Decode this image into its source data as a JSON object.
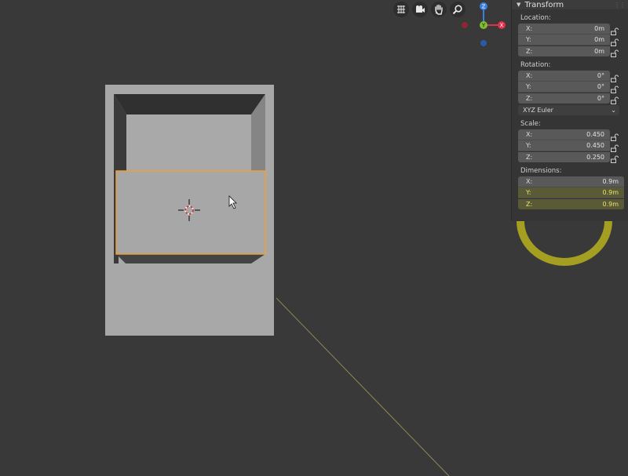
{
  "viewport": {
    "tools": [
      {
        "name": "grid-icon"
      },
      {
        "name": "camera-icon"
      },
      {
        "name": "hand-icon"
      },
      {
        "name": "zoom-icon"
      }
    ],
    "gizmo": {
      "z_label": "Z",
      "y_label": "Y",
      "x_label": "X",
      "colors": {
        "x": "#e0304a",
        "y": "#7fbf2f",
        "z": "#3a7fe0"
      }
    }
  },
  "panel": {
    "title": "Transform",
    "location": {
      "label": "Location:",
      "x_label": "X:",
      "x": "0m",
      "y_label": "Y:",
      "y": "0m",
      "z_label": "Z:",
      "z": "0m"
    },
    "rotation": {
      "label": "Rotation:",
      "x_label": "X:",
      "x": "0°",
      "y_label": "Y:",
      "y": "0°",
      "z_label": "Z:",
      "z": "0°"
    },
    "rotation_mode": "XYZ Euler",
    "scale": {
      "label": "Scale:",
      "x_label": "X:",
      "x": "0.450",
      "y_label": "Y:",
      "y": "0.450",
      "z_label": "Z:",
      "z": "0.250"
    },
    "dimensions": {
      "label": "Dimensions:",
      "x_label": "X:",
      "x": "0.9m",
      "y_label": "Y:",
      "y": "0.9m",
      "z_label": "Z:",
      "z": "0.9m"
    }
  },
  "colors": {
    "background": "#393939",
    "selection": "#f0a030",
    "annotation": "#c8c01a"
  }
}
